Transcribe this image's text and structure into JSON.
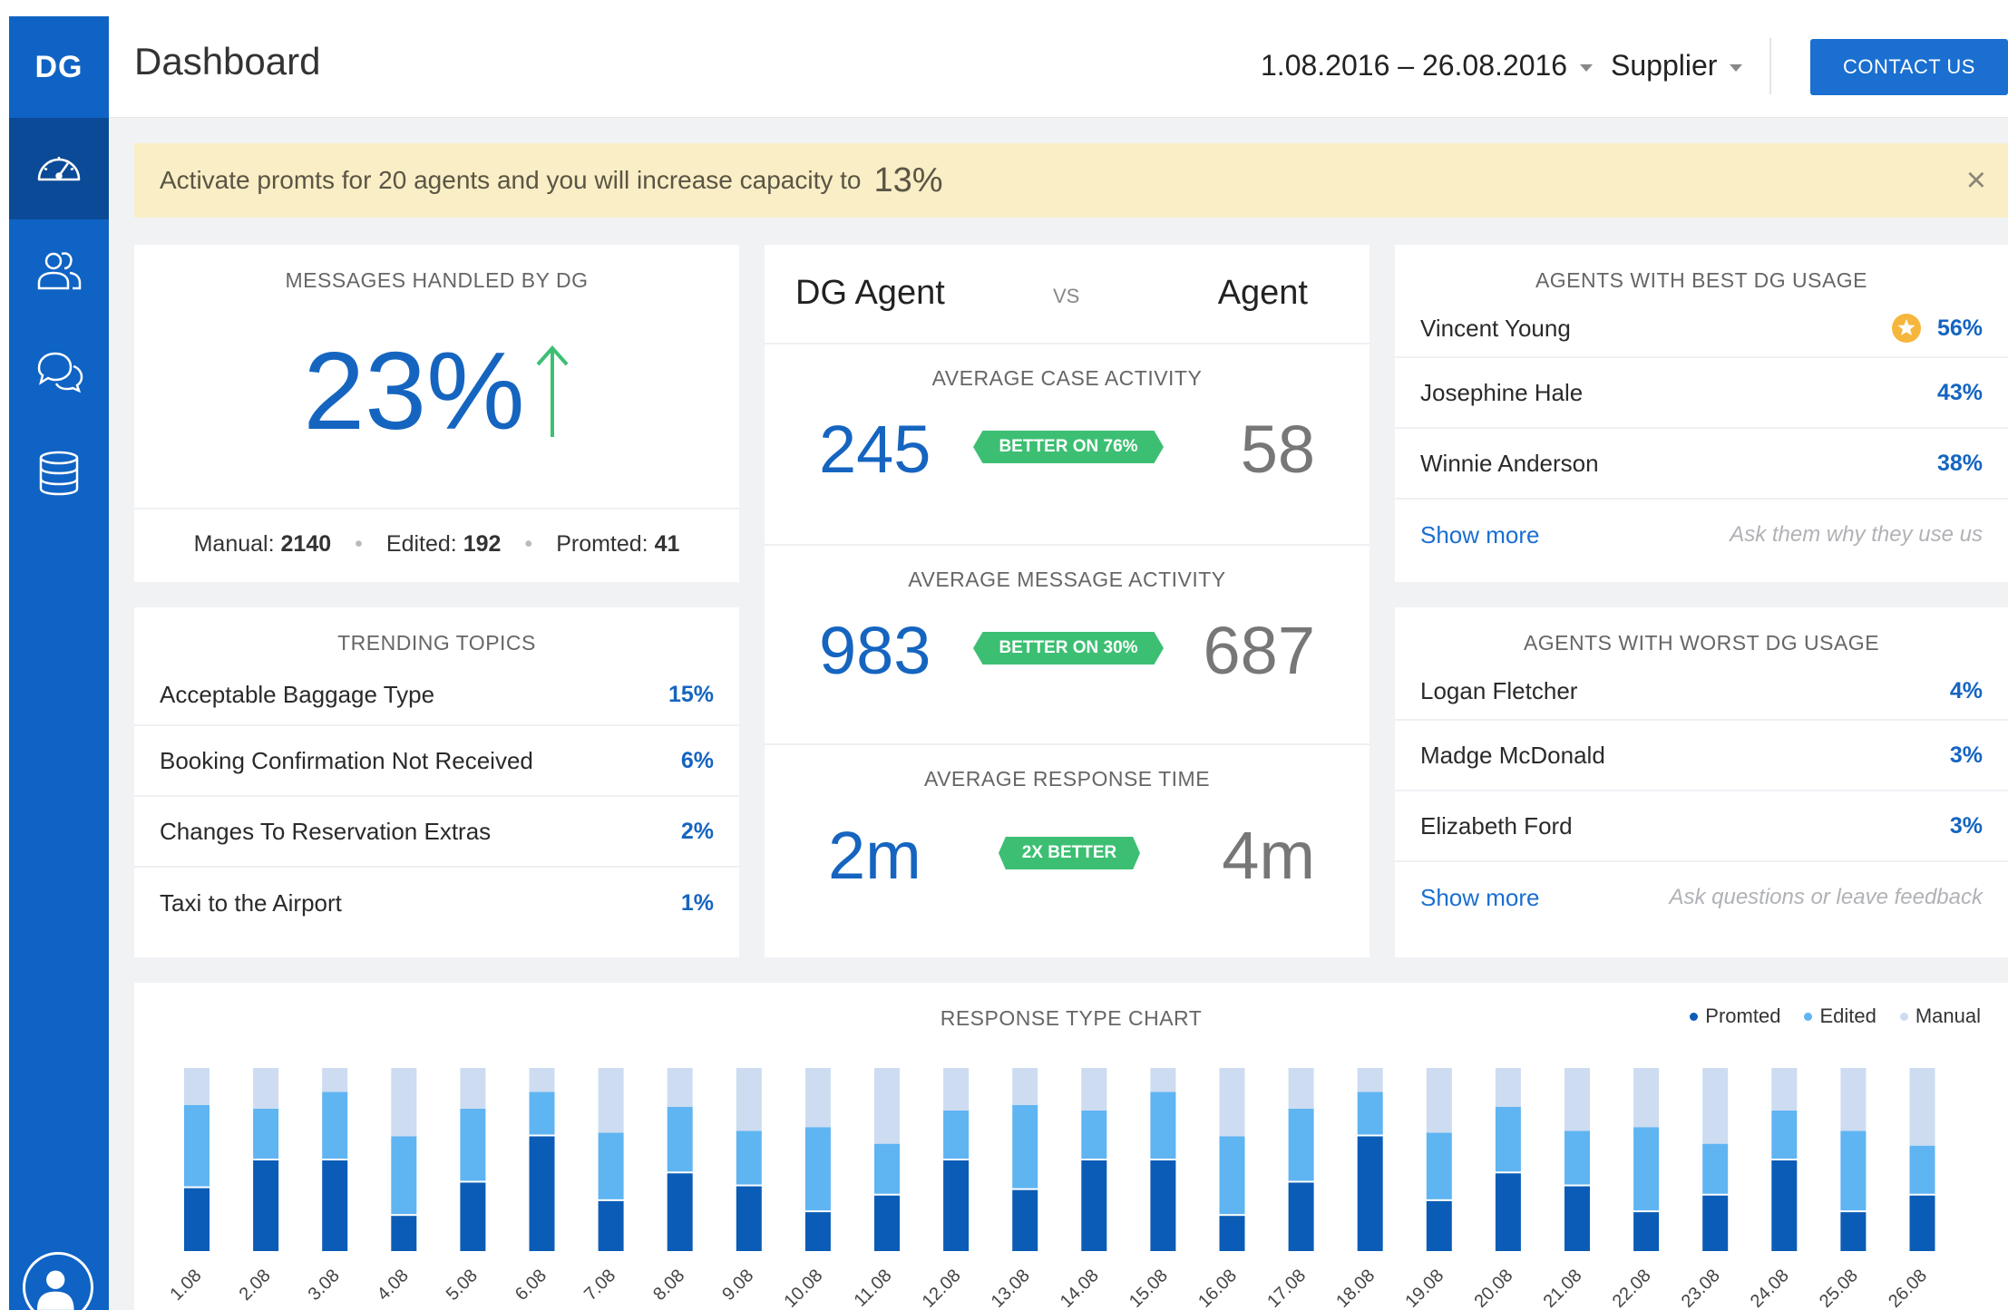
{
  "sidebar": {
    "logo": "DG",
    "nav": [
      {
        "icon": "speedometer-icon",
        "active": true
      },
      {
        "icon": "users-icon",
        "active": false
      },
      {
        "icon": "chat-icon",
        "active": false
      },
      {
        "icon": "database-icon",
        "active": false
      }
    ],
    "profile_icon": "user-avatar-icon"
  },
  "header": {
    "title": "Dashboard",
    "date_range": "1.08.2016 – 26.08.2016",
    "supplier": "Supplier",
    "contact": "CONTACT US"
  },
  "banner": {
    "text": "Activate promts for 20 agents and you will increase capacity to",
    "value": "13%",
    "close": "×"
  },
  "messages": {
    "title": "MESSAGES HANDLED BY DG",
    "value": "23%",
    "trend": "up",
    "manual_label": "Manual:",
    "manual": "2140",
    "edited_label": "Edited:",
    "edited": "192",
    "promted_label": "Promted:",
    "promted": "41"
  },
  "trending": {
    "title": "TRENDING TOPICS",
    "items": [
      {
        "label": "Acceptable Baggage Type",
        "value": "15%"
      },
      {
        "label": "Booking Confirmation Not Received",
        "value": "6%"
      },
      {
        "label": "Changes To Reservation Extras",
        "value": "2%"
      },
      {
        "label": "Taxi to the Airport",
        "value": "1%"
      }
    ]
  },
  "compare": {
    "left": "DG Agent",
    "vs": "VS",
    "right": "Agent",
    "metrics": [
      {
        "title": "AVERAGE CASE ACTIVITY",
        "dg": "245",
        "badge": "BETTER ON 76%",
        "agent": "58"
      },
      {
        "title": "AVERAGE MESSAGE ACTIVITY",
        "dg": "983",
        "badge": "BETTER ON 30%",
        "agent": "687"
      },
      {
        "title": "AVERAGE RESPONSE TIME",
        "dg": "2m",
        "badge": "2X BETTER",
        "agent": "4m"
      }
    ]
  },
  "best": {
    "title": "AGENTS WITH BEST DG USAGE",
    "items": [
      {
        "name": "Vincent Young",
        "value": "56%",
        "star": true
      },
      {
        "name": "Josephine Hale",
        "value": "43%"
      },
      {
        "name": "Winnie Anderson",
        "value": "38%"
      }
    ],
    "show_more": "Show more",
    "hint": "Ask them why they use us"
  },
  "worst": {
    "title": "AGENTS WITH WORST DG USAGE",
    "items": [
      {
        "name": "Logan Fletcher",
        "value": "4%"
      },
      {
        "name": "Madge McDonald",
        "value": "3%"
      },
      {
        "name": "Elizabeth Ford",
        "value": "3%"
      }
    ],
    "show_more": "Show more",
    "hint": "Ask questions or leave feedback"
  },
  "colors": {
    "promted": "#0b5cb6",
    "edited": "#5fb4f2",
    "manual": "#cddcf1",
    "accent": "#1565c0",
    "badge": "#3dbf73"
  },
  "chart_data": {
    "type": "bar",
    "stacked": true,
    "title": "RESPONSE TYPE CHART",
    "categories": [
      "1.08",
      "2.08",
      "3.08",
      "4.08",
      "5.08",
      "6.08",
      "7.08",
      "8.08",
      "9.08",
      "10.08",
      "11.08",
      "12.08",
      "13.08",
      "14.08",
      "15.08",
      "16.08",
      "17.08",
      "18.08",
      "19.08",
      "20.08",
      "21.08",
      "22.08",
      "23.08",
      "24.08",
      "25.08",
      "26.08"
    ],
    "series": [
      {
        "name": "Promted",
        "values": [
          35,
          50,
          50,
          20,
          38,
          63,
          28,
          43,
          36,
          22,
          31,
          50,
          34,
          50,
          50,
          20,
          38,
          63,
          28,
          43,
          36,
          22,
          31,
          50,
          22,
          31
        ]
      },
      {
        "name": "Edited",
        "values": [
          45,
          28,
          37,
          43,
          40,
          24,
          37,
          36,
          30,
          46,
          28,
          27,
          46,
          27,
          37,
          43,
          40,
          24,
          37,
          36,
          30,
          46,
          28,
          27,
          44,
          27
        ]
      },
      {
        "name": "Manual",
        "values": [
          20,
          22,
          13,
          37,
          22,
          13,
          35,
          21,
          34,
          32,
          41,
          23,
          20,
          23,
          13,
          37,
          22,
          13,
          35,
          21,
          34,
          32,
          41,
          23,
          34,
          42
        ]
      }
    ],
    "ylim": [
      0,
      100
    ],
    "legend": "top-right"
  }
}
